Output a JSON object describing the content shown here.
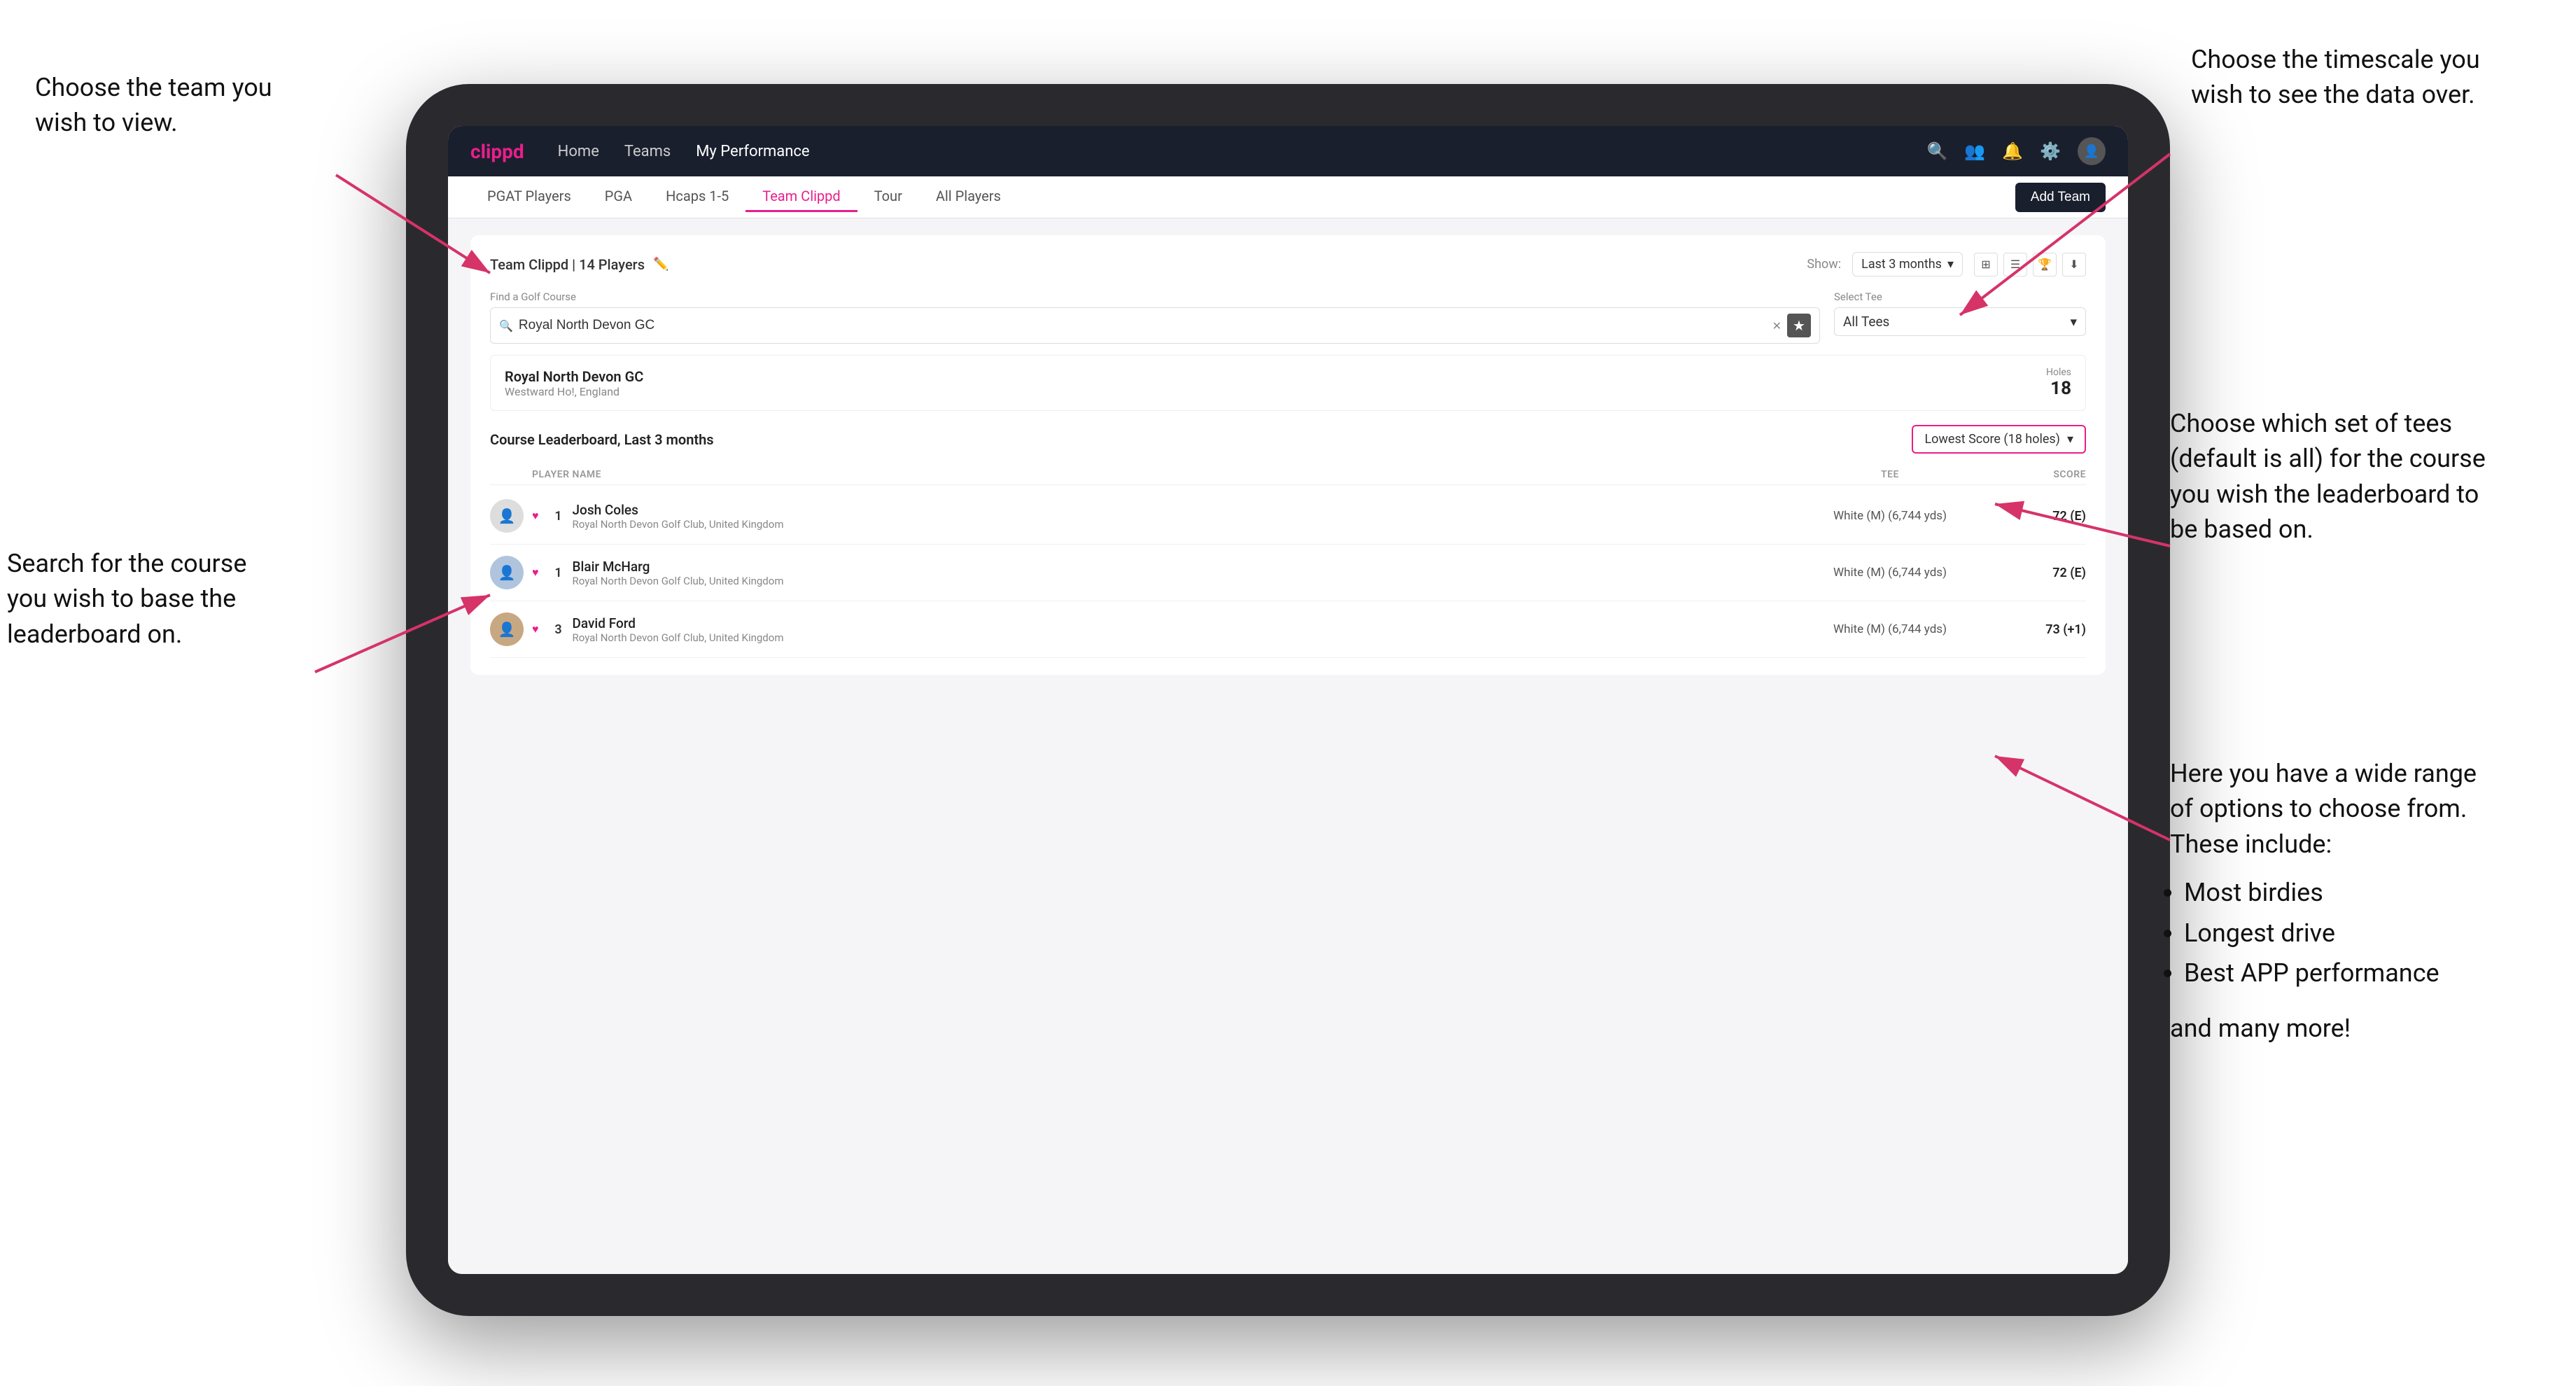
{
  "annotations": {
    "top_left": {
      "line1": "Choose the team you",
      "line2": "wish to view."
    },
    "bottom_left": {
      "line1": "Search for the course",
      "line2": "you wish to base the",
      "line3": "leaderboard on."
    },
    "top_right": {
      "line1": "Choose the timescale you",
      "line2": "wish to see the data over."
    },
    "mid_right": {
      "line1": "Choose which set of tees",
      "line2": "(default is all) for the course",
      "line3": "you wish the leaderboard to",
      "line4": "be based on."
    },
    "bottom_right": {
      "line1": "Here you have a wide range",
      "line2": "of options to choose from.",
      "line3": "These include:",
      "bullets": [
        "Most birdies",
        "Longest drive",
        "Best APP performance"
      ],
      "more": "and many more!"
    }
  },
  "navbar": {
    "logo": "clippd",
    "links": [
      "Home",
      "Teams",
      "My Performance"
    ],
    "active_link": "My Performance"
  },
  "sub_tabs": {
    "tabs": [
      "PGAT Players",
      "PGA",
      "Hcaps 1-5",
      "Team Clippd",
      "Tour",
      "All Players"
    ],
    "active_tab": "Team Clippd",
    "add_team_label": "Add Team"
  },
  "team_section": {
    "title": "Team Clippd",
    "player_count": "14 Players",
    "show_label": "Show:",
    "show_value": "Last 3 months"
  },
  "search_section": {
    "find_label": "Find a Golf Course",
    "search_value": "Royal North Devon GC",
    "tee_label": "Select Tee",
    "tee_value": "All Tees"
  },
  "course_result": {
    "name": "Royal North Devon GC",
    "location": "Westward Ho!, England",
    "holes_label": "Holes",
    "holes_value": "18"
  },
  "leaderboard": {
    "title": "Course Leaderboard,",
    "period": "Last 3 months",
    "sort_label": "Lowest Score (18 holes)",
    "columns": {
      "player": "PLAYER NAME",
      "tee": "TEE",
      "score": "SCORE"
    },
    "players": [
      {
        "rank": "1",
        "name": "Josh Coles",
        "club": "Royal North Devon Golf Club, United Kingdom",
        "tee": "White (M) (6,744 yds)",
        "score": "72 (E)"
      },
      {
        "rank": "1",
        "name": "Blair McHarg",
        "club": "Royal North Devon Golf Club, United Kingdom",
        "tee": "White (M) (6,744 yds)",
        "score": "72 (E)"
      },
      {
        "rank": "3",
        "name": "David Ford",
        "club": "Royal North Devon Golf Club, United Kingdom",
        "tee": "White (M) (6,744 yds)",
        "score": "73 (+1)"
      }
    ]
  }
}
